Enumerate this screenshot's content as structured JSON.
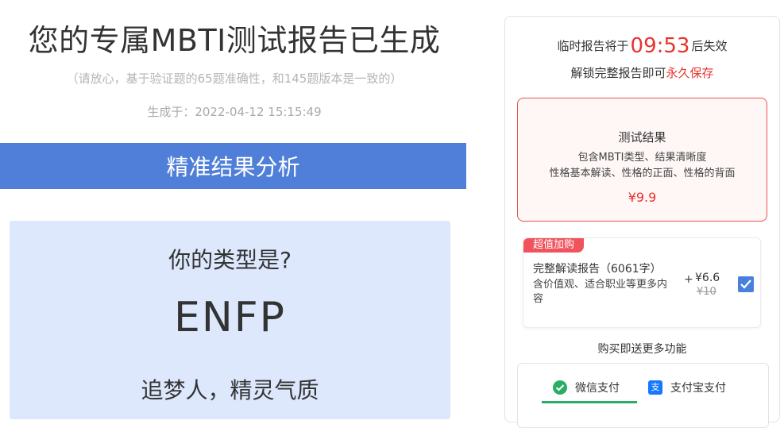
{
  "left": {
    "title": "您的专属MBTI测试报告已生成",
    "subtitle": "（请放心，基于验证题的65题准确性，和145题版本是一致的）",
    "generated": "生成于：2022-04-12 15:15:49",
    "banner": "精准结果分析",
    "result": {
      "question": "你的类型是?",
      "type": "ENFP",
      "name": "追梦人，精灵气质"
    }
  },
  "panel": {
    "timer_prefix": "临时报告将于",
    "countdown": "09:53",
    "timer_suffix": "后失效",
    "save_prefix": "解锁完整报告即可",
    "save_highlight": "永久保存",
    "card1": {
      "title": "测试结果",
      "line1": "包含MBTI类型、结果清晰度",
      "line2": "性格基本解读、性格的正面、性格的背面",
      "price": "¥9.9"
    },
    "card2": {
      "badge": "超值加购",
      "main": "完整解读报告（6061字）",
      "desc": "含价值观、适合职业等更多内容",
      "plus": "+",
      "price": "¥6.6",
      "old_price": "¥10",
      "checked": true
    },
    "more": "购买即送更多功能",
    "pay": {
      "wechat": "微信支付",
      "alipay": "支付宝支付"
    }
  },
  "colors": {
    "accent_blue": "#4f7fd8",
    "red": "#e8322d",
    "wechat_green": "#2aae67",
    "alipay_blue": "#1677ff"
  }
}
